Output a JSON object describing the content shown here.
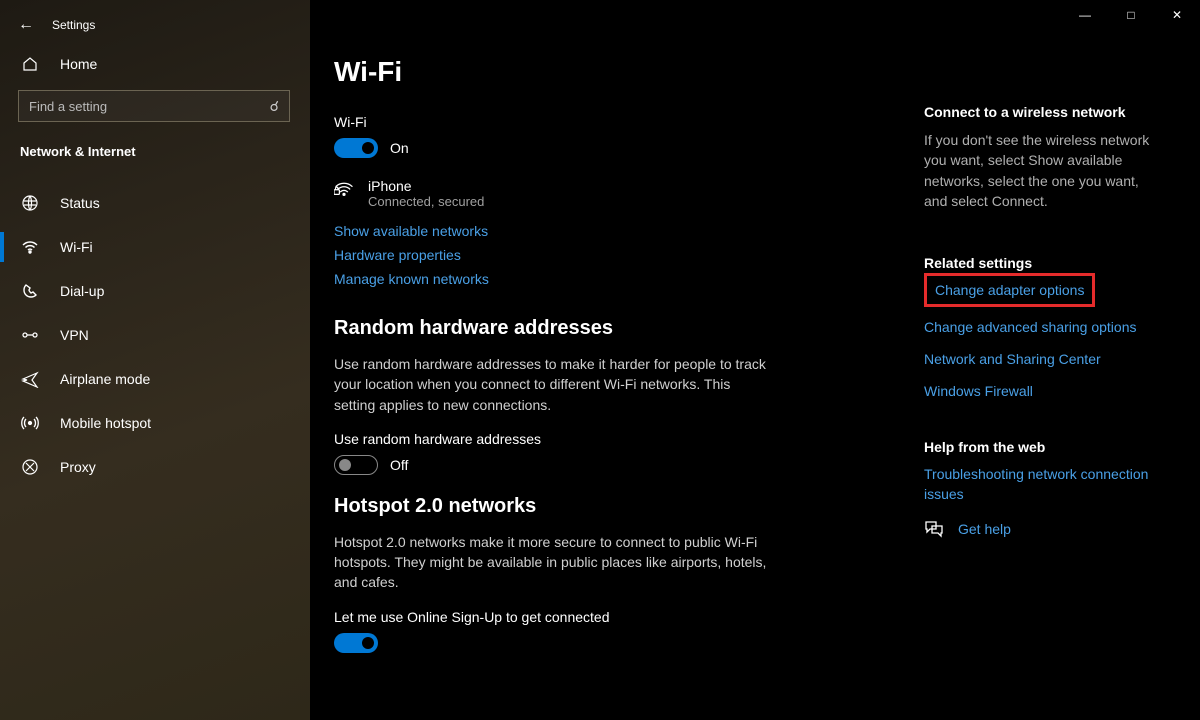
{
  "app_title": "Settings",
  "home_label": "Home",
  "search_placeholder": "Find a setting",
  "category_title": "Network & Internet",
  "nav": {
    "items": [
      {
        "label": "Status"
      },
      {
        "label": "Wi-Fi"
      },
      {
        "label": "Dial-up"
      },
      {
        "label": "VPN"
      },
      {
        "label": "Airplane mode"
      },
      {
        "label": "Mobile hotspot"
      },
      {
        "label": "Proxy"
      }
    ],
    "active_index": 1
  },
  "main": {
    "title": "Wi-Fi",
    "wifi_label": "Wi-Fi",
    "wifi_toggle": {
      "state": "on",
      "text": "On"
    },
    "connection": {
      "name": "iPhone",
      "status": "Connected, secured"
    },
    "links": {
      "show_networks": "Show available networks",
      "hardware_props": "Hardware properties",
      "manage_known": "Manage known networks"
    },
    "random_hw": {
      "title": "Random hardware addresses",
      "body": "Use random hardware addresses to make it harder for people to track your location when you connect to different Wi-Fi networks. This setting applies to new connections.",
      "toggle_label": "Use random hardware addresses",
      "toggle_state": "off",
      "toggle_text": "Off"
    },
    "hotspot": {
      "title": "Hotspot 2.0 networks",
      "body": "Hotspot 2.0 networks make it more secure to connect to public Wi-Fi hotspots. They might be available in public places like airports, hotels, and cafes.",
      "toggle_label": "Let me use Online Sign-Up to get connected"
    }
  },
  "right": {
    "connect_title": "Connect to a wireless network",
    "connect_body": "If you don't see the wireless network you want, select Show available networks, select the one you want, and select Connect.",
    "related_title": "Related settings",
    "related": {
      "adapter": "Change adapter options",
      "sharing": "Change advanced sharing options",
      "center": "Network and Sharing Center",
      "firewall": "Windows Firewall"
    },
    "help_title": "Help from the web",
    "help_link": "Troubleshooting network connection issues",
    "get_help": "Get help"
  }
}
